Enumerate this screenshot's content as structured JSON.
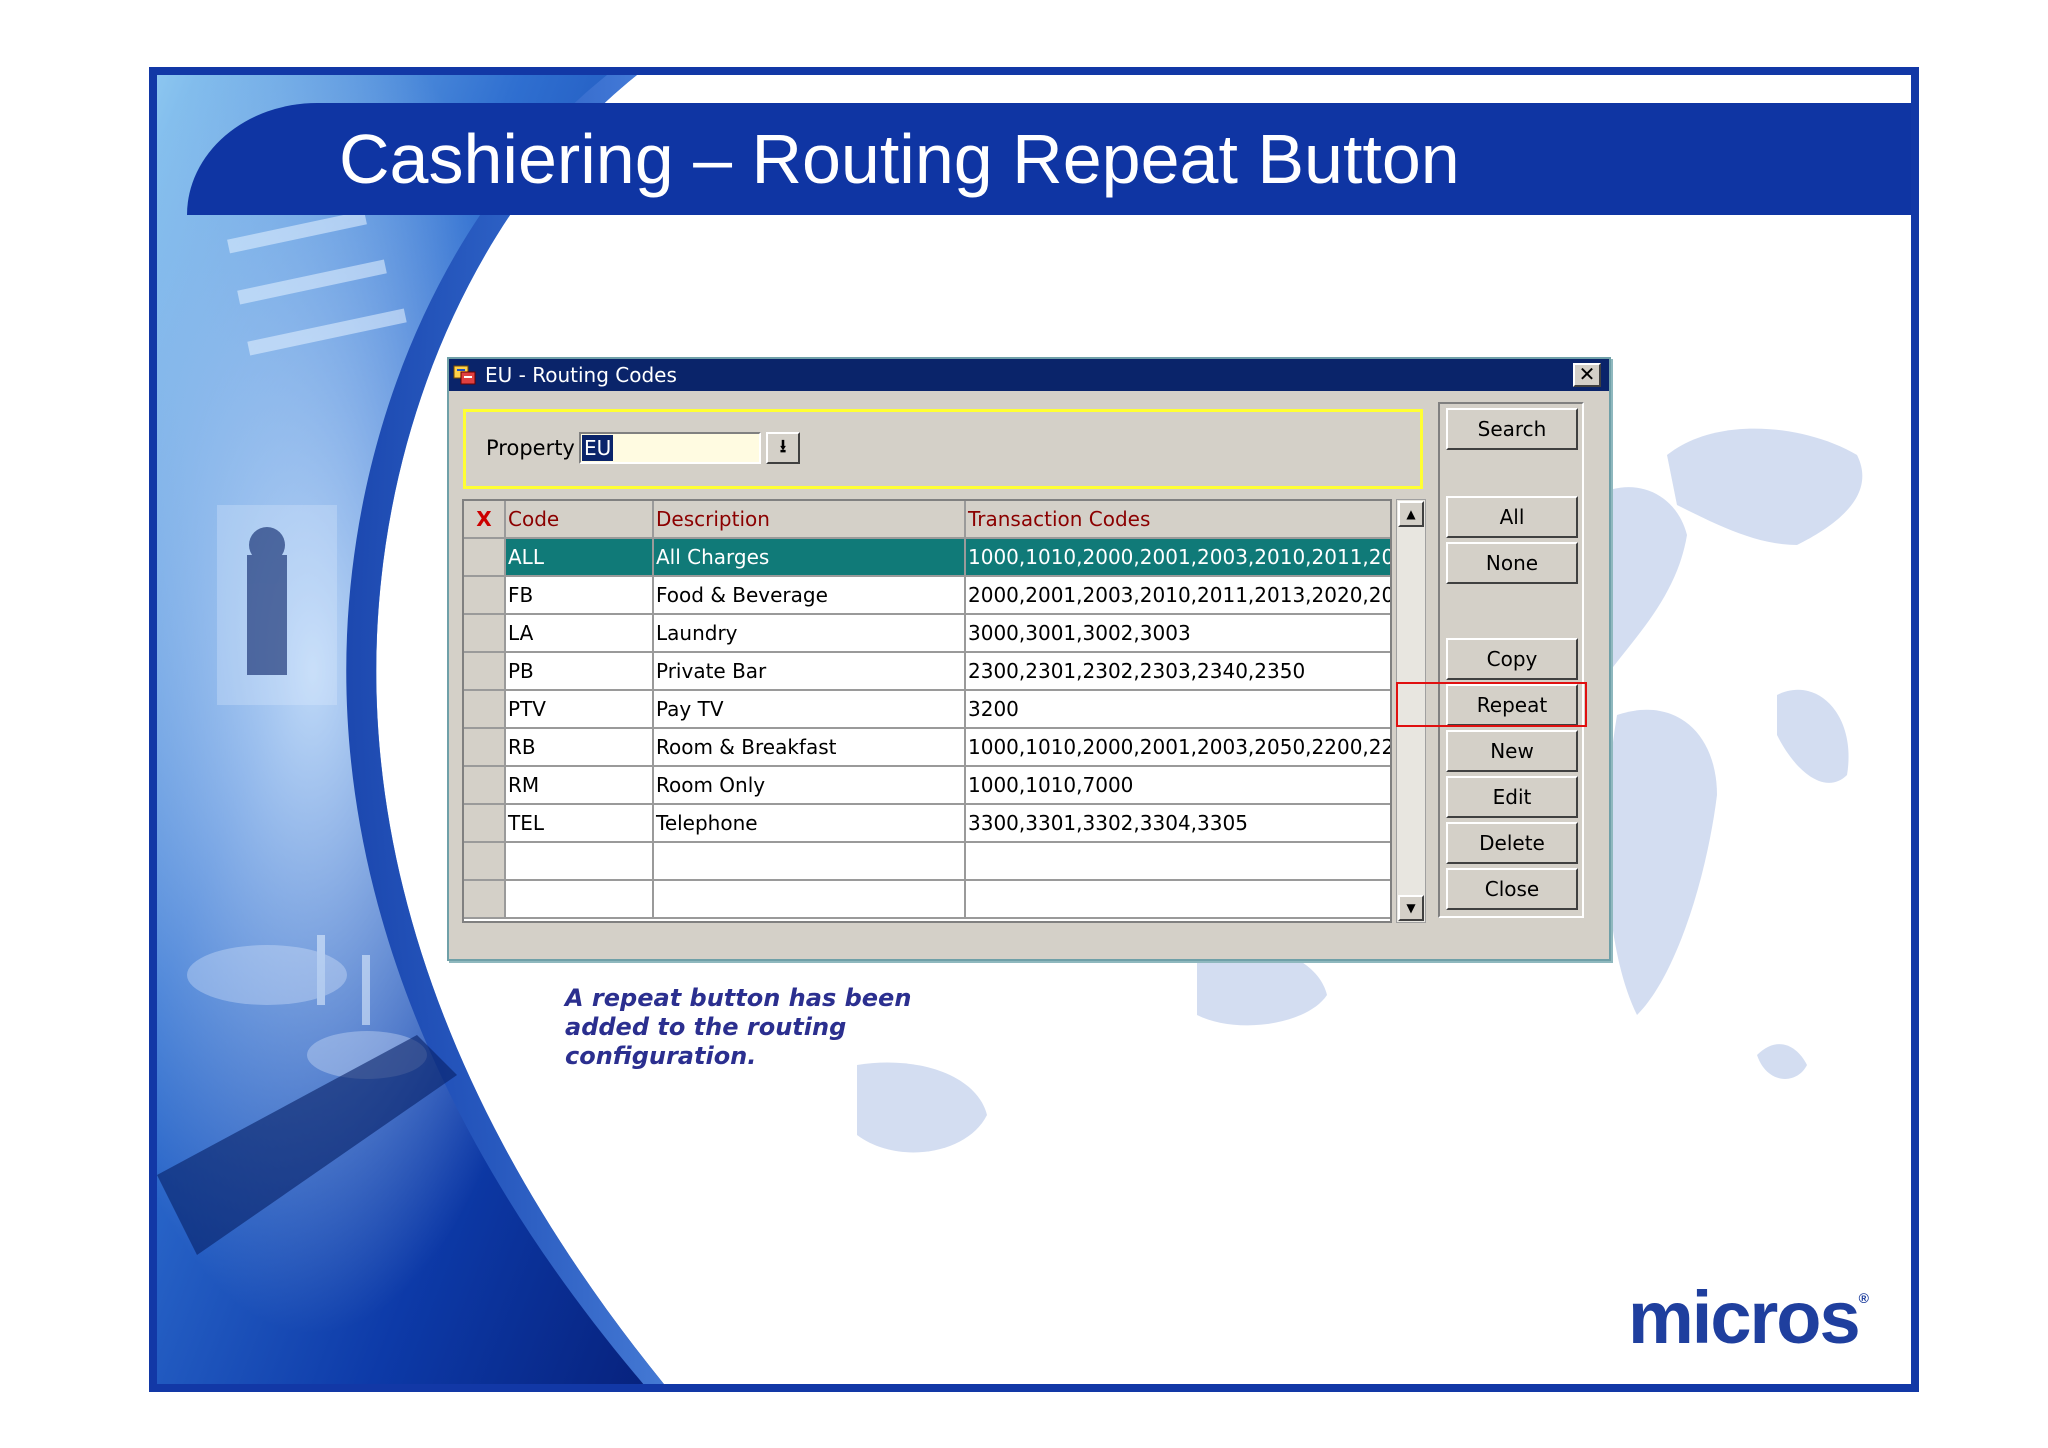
{
  "slide": {
    "title": "Cashiering – Routing Repeat Button",
    "caption": "A repeat button has been added to the routing configuration.",
    "logo_text": "micros",
    "logo_mark": "®"
  },
  "dialog": {
    "title": "EU - Routing Codes",
    "close_glyph": "✕",
    "property_label": "Property",
    "property_value": "EU",
    "dropdown_glyph": "⭳",
    "table": {
      "delete_marker": "X",
      "columns": [
        "Code",
        "Description",
        "Transaction Codes"
      ],
      "rows": [
        [
          "ALL",
          "All Charges",
          "1000,1010,2000,2001,2003,2010,2011,20"
        ],
        [
          "FB",
          "Food & Beverage",
          "2000,2001,2003,2010,2011,2013,2020,20"
        ],
        [
          "LA",
          "Laundry",
          "3000,3001,3002,3003"
        ],
        [
          "PB",
          "Private Bar",
          "2300,2301,2302,2303,2340,2350"
        ],
        [
          "PTV",
          "Pay TV",
          "3200"
        ],
        [
          "RB",
          "Room & Breakfast",
          "1000,1010,2000,2001,2003,2050,2200,22"
        ],
        [
          "RM",
          "Room Only",
          "1000,1010,7000"
        ],
        [
          "TEL",
          "Telephone",
          "3300,3301,3302,3304,3305"
        ],
        [
          "",
          "",
          ""
        ],
        [
          "",
          "",
          ""
        ]
      ],
      "selected_row": 0
    },
    "buttons": {
      "search": "Search",
      "all": "All",
      "none": "None",
      "copy": "Copy",
      "repeat": "Repeat",
      "new": "New",
      "edit": "Edit",
      "delete": "Delete",
      "close": "Close"
    },
    "highlighted_button": "repeat",
    "icons": {
      "app": "app-icon",
      "dropdown": "dropdown-arrow-icon",
      "scroll_up": "scroll-up-icon",
      "scroll_down": "scroll-down-icon"
    }
  },
  "colors": {
    "title_bar": "#0f35a3",
    "dialog_titlebar": "#0a246a",
    "selected_row": "#107a78",
    "highlight_frame": "#e01010",
    "caption": "#2b2f8f",
    "property_frame": "#ffff33"
  }
}
